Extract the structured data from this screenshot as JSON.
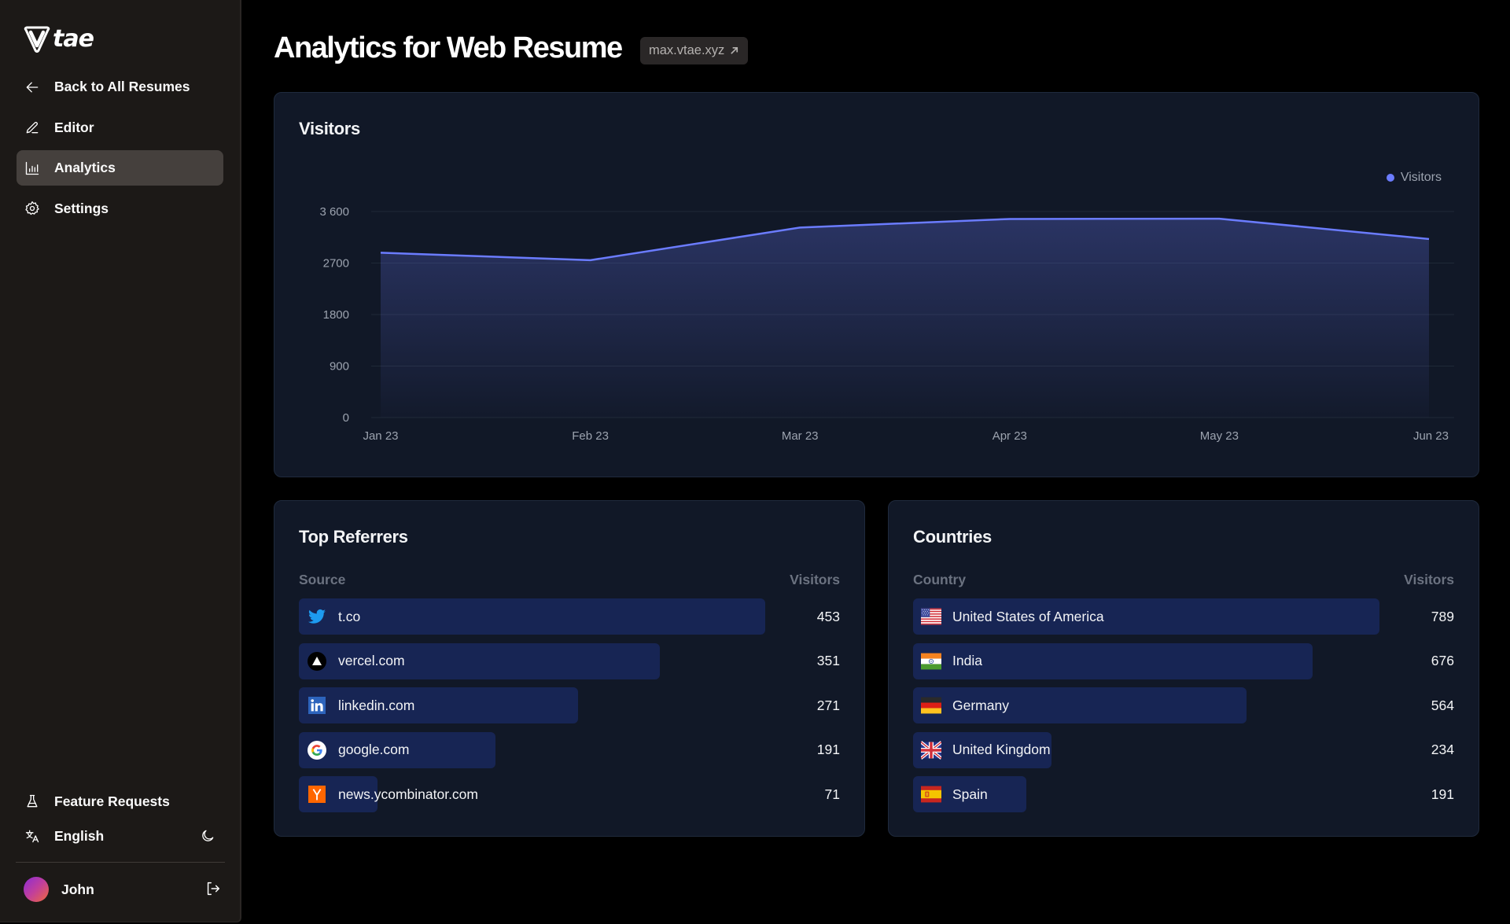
{
  "app": {
    "logo_text": "tae",
    "logo_mark": "V"
  },
  "sidebar": {
    "items": [
      {
        "label": "Back to All Resumes",
        "icon": "arrow-left-icon",
        "active": false
      },
      {
        "label": "Editor",
        "icon": "pencil-icon",
        "active": false
      },
      {
        "label": "Analytics",
        "icon": "bar-chart-icon",
        "active": true
      },
      {
        "label": "Settings",
        "icon": "gear-icon",
        "active": false
      }
    ],
    "bottom_items": [
      {
        "label": "Feature Requests",
        "icon": "flask-icon"
      },
      {
        "label": "English",
        "icon": "translate-icon"
      }
    ],
    "theme_toggle_icon": "moon-icon",
    "user": {
      "name": "John",
      "logout_icon": "logout-icon"
    }
  },
  "header": {
    "title": "Analytics for Web Resume",
    "site_link": "max.vtae.xyz",
    "site_link_icon": "external-arrow-icon"
  },
  "visitors_card": {
    "title": "Visitors",
    "legend": "Visitors"
  },
  "chart_data": {
    "type": "area",
    "title": "Visitors",
    "xlabel": "",
    "ylabel": "",
    "x": [
      "Jan 23",
      "Feb 23",
      "Mar 23",
      "Apr 23",
      "May 23",
      "Jun 23"
    ],
    "series": [
      {
        "name": "Visitors",
        "values": [
          2880,
          2750,
          3320,
          3470,
          3475,
          3120
        ],
        "color": "#6b7cff"
      }
    ],
    "yticks": [
      0,
      900,
      1800,
      2700,
      3600
    ],
    "ytick_labels": [
      "0",
      "900",
      "1800",
      "2700",
      "3 600"
    ],
    "ylim": [
      0,
      3600
    ],
    "grid": true,
    "legend": "top-right"
  },
  "referrers": {
    "title": "Top Referrers",
    "col_source": "Source",
    "col_visitors": "Visitors",
    "rows": [
      {
        "label": "t.co",
        "icon": "twitter-icon",
        "value": 453
      },
      {
        "label": "vercel.com",
        "icon": "vercel-icon",
        "value": 351
      },
      {
        "label": "linkedin.com",
        "icon": "linkedin-icon",
        "value": 271
      },
      {
        "label": "google.com",
        "icon": "google-icon",
        "value": 191
      },
      {
        "label": "news.ycombinator.com",
        "icon": "ycombinator-icon",
        "value": 71
      }
    ]
  },
  "countries": {
    "title": "Countries",
    "col_country": "Country",
    "col_visitors": "Visitors",
    "rows": [
      {
        "label": "United States of America",
        "icon": "flag-us-icon",
        "value": 789
      },
      {
        "label": "India",
        "icon": "flag-in-icon",
        "value": 676
      },
      {
        "label": "Germany",
        "icon": "flag-de-icon",
        "value": 564
      },
      {
        "label": "United Kingdom",
        "icon": "flag-gb-icon",
        "value": 234
      },
      {
        "label": "Spain",
        "icon": "flag-es-icon",
        "value": 191
      }
    ]
  },
  "colors": {
    "accent": "#6b7cff",
    "bar": "#172554",
    "card_bg": "#111827",
    "sidebar_bg": "#1c1917",
    "active_item": "#45403d"
  }
}
